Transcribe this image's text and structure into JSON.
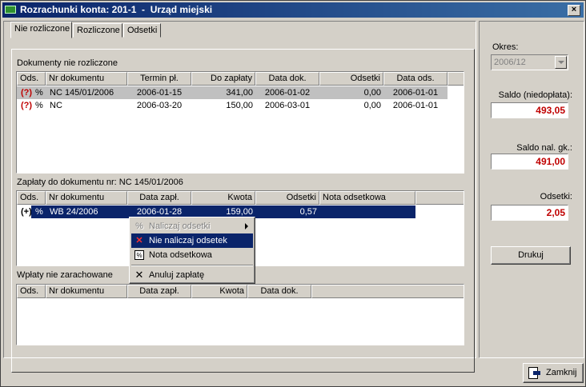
{
  "window": {
    "title": "Rozrachunki konta: 201-1  -  Urząd miejski",
    "close_glyph": "×"
  },
  "tabs": [
    {
      "label": "Nie rozliczone",
      "active": true
    },
    {
      "label": "Rozliczone"
    },
    {
      "label": "Odsetki"
    }
  ],
  "docs": {
    "label": "Dokumenty nie rozliczone",
    "columns": [
      "Ods.",
      "Nr dokumentu",
      "Termin pł.",
      "Do zapłaty",
      "Data dok.",
      "Odsetki",
      "Data ods."
    ],
    "rows": [
      {
        "status": "(?)",
        "ods": "%",
        "nr": "NC 145/01/2006",
        "termin": "2006-01-15",
        "do_zaplaty": "341,00",
        "data_dok": "2006-01-02",
        "odsetki": "0,00",
        "data_ods": "2006-01-01",
        "selected": true
      },
      {
        "status": "(?)",
        "ods": "%",
        "nr": "NC",
        "termin": "2006-03-20",
        "do_zaplaty": "150,00",
        "data_dok": "2006-03-01",
        "odsetki": "0,00",
        "data_ods": "2006-01-01"
      }
    ]
  },
  "payments": {
    "label": "Zapłaty do dokumentu nr: NC 145/01/2006",
    "columns": [
      "Ods.",
      "Nr dokumentu",
      "Data zapł.",
      "Kwota",
      "Odsetki",
      "Nota odsetkowa"
    ],
    "rows": [
      {
        "status": "(+)",
        "ods": "%",
        "nr": "WB 24/2006",
        "data": "2006-01-28",
        "kwota": "159,00",
        "odsetki": "0,57",
        "nota": ""
      }
    ]
  },
  "unassigned": {
    "label": "Wpłaty nie zarachowane",
    "columns": [
      "Ods.",
      "Nr dokumentu",
      "Data zapł.",
      "Kwota",
      "Data dok."
    ]
  },
  "context_menu": {
    "items": [
      {
        "label": "Naliczaj odsetki",
        "icon": "percent-icon",
        "disabled": true,
        "submenu": true
      },
      {
        "label": "Nie naliczaj odsetek",
        "icon": "red-x-icon",
        "selected": true
      },
      {
        "label": "Nota odsetkowa",
        "icon": "note-icon"
      },
      {
        "label": "Anuluj zapłatę",
        "icon": "cancel-x-icon"
      }
    ]
  },
  "right": {
    "okres_label": "Okres:",
    "okres_value": "2006/12",
    "saldo_label": "Saldo (niedopłata):",
    "saldo_value": "493,05",
    "saldo_gk_label": "Saldo nal. gk.:",
    "saldo_gk_value": "491,00",
    "odsetki_label": "Odsetki:",
    "odsetki_value": "2,05",
    "drukuj_label": "Drukuj"
  },
  "footer": {
    "zamknij_label": "Zamknij"
  },
  "colors": {
    "title_bar": "#0a246a",
    "selection": "#0a246a",
    "value_red": "#c00000"
  }
}
